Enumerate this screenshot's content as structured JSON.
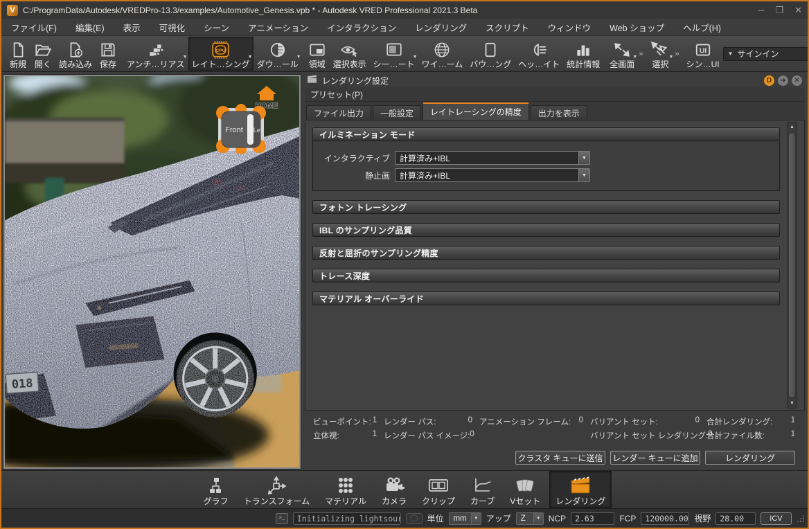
{
  "window": {
    "title": "C:/ProgramData/Autodesk/VREDPro-13.3/examples/Automotive_Genesis.vpb * - Autodesk VRED Professional 2021.3 Beta",
    "logo_letter": "V",
    "controls": {
      "minimize": "─",
      "maximize": "❐",
      "close": "✕"
    }
  },
  "menubar": {
    "items": [
      "ファイル(F)",
      "編集(E)",
      "表示",
      "可視化",
      "シーン",
      "アニメーション",
      "インタラクション",
      "レンダリング",
      "スクリプト",
      "ウィンドウ",
      "Web ショップ",
      "ヘルプ(H)"
    ]
  },
  "toolbar": {
    "tools": [
      {
        "label": "新規"
      },
      {
        "label": "開く"
      },
      {
        "label": "読み込み"
      },
      {
        "label": "保存"
      },
      {
        "label": "アンチ…リアス"
      },
      {
        "label": "レイト…シング"
      },
      {
        "label": "ダウ…ール"
      },
      {
        "label": "領域"
      },
      {
        "label": "選択表示"
      },
      {
        "label": "シー…ート"
      },
      {
        "label": "ワイ…ーム"
      },
      {
        "label": "バウ…ング"
      },
      {
        "label": "ヘッ…イト"
      },
      {
        "label": "統計情報"
      },
      {
        "label": "全画面"
      },
      {
        "label": "選択"
      },
      {
        "label": "シン…UI"
      }
    ],
    "cpu_text": "CPU",
    "ui_text": "UI",
    "signin_label": "サインイン"
  },
  "viewport": {
    "home_label": "HOME",
    "cube_front_label": "Front",
    "cube_left_label": "Lef",
    "license_plate": "018"
  },
  "panel": {
    "title": "レンダリング設定",
    "menu": "プリセット(P)",
    "tabs": [
      "ファイル出力",
      "一般設定",
      "レイトレーシングの精度",
      "出力を表示"
    ],
    "illumination": {
      "title": "イルミネーション モード",
      "rows": [
        {
          "label": "インタラクティブ",
          "value": "計算済み+IBL"
        },
        {
          "label": "静止画",
          "value": "計算済み+IBL"
        }
      ]
    },
    "collapsed_sections": [
      "フォトン トレーシング",
      "IBL のサンプリング品質",
      "反射と屈折のサンプリング精度",
      "トレース深度",
      "マテリアル オーバーライド"
    ],
    "stats": {
      "col1": [
        {
          "label": "ビューポイント:",
          "value": "1"
        },
        {
          "label": "立体視:",
          "value": "1"
        }
      ],
      "col2": [
        {
          "label": "レンダー パス:",
          "value": "0"
        },
        {
          "label": "レンダー パス イメージ:",
          "value": "0"
        }
      ],
      "col3": [
        {
          "label": "アニメーション フレーム:",
          "value": "0"
        }
      ],
      "col4": [
        {
          "label": "バリアント セット:",
          "value": "0"
        },
        {
          "label": "バリアント セット レンダリング:",
          "value": "0"
        }
      ],
      "col5": [
        {
          "label": "合計レンダリング:",
          "value": "1"
        },
        {
          "label": "合計ファイル数:",
          "value": "1"
        }
      ]
    },
    "actions": [
      "クラスタ キューに送信",
      "レンダー キューに追加",
      "レンダリング"
    ]
  },
  "modulebar": {
    "items": [
      "グラフ",
      "トランスフォーム",
      "マテリアル",
      "カメラ",
      "クリップ",
      "カーブ",
      "Vセット",
      "レンダリング"
    ]
  },
  "statusbar": {
    "terminal_glyph": ">_",
    "message": "Initializing lightsourc…",
    "unit_label": "単位",
    "unit_value": "mm",
    "up_label": "アップ",
    "up_value": "Z",
    "ncp_label": "NCP",
    "ncp_value": "2.63",
    "fcp_label": "FCP",
    "fcp_value": "120000.00",
    "fov_label": "視野",
    "fov_value": "28.00",
    "icv_label": "ICV"
  },
  "colors": {
    "accent": "#e8891e",
    "panel_bg": "#3c3c3c"
  }
}
